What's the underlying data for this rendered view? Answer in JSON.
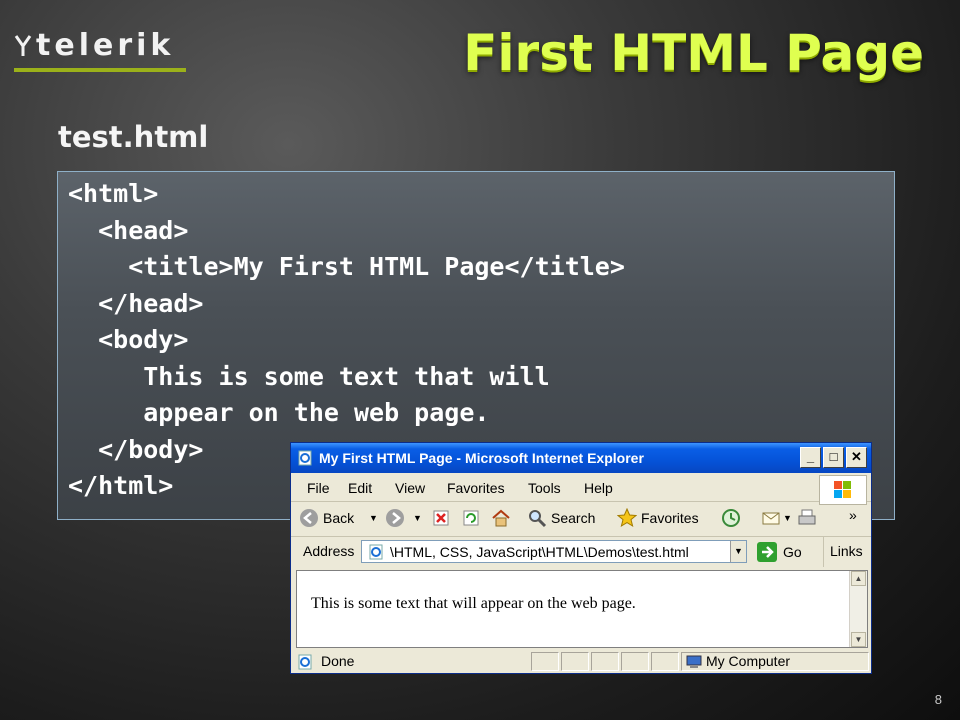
{
  "logo": {
    "text": "telerik"
  },
  "slide": {
    "title": "First HTML Page",
    "filename": "test.html",
    "code": "<html>\n  <head>\n    <title>My First HTML Page</title>\n  </head>\n  <body>\n     This is some text that will\n     appear on the web page.\n  </body>\n</html>",
    "page_number": "8"
  },
  "browser": {
    "title": "My First HTML Page - Microsoft Internet Explorer",
    "window_buttons": {
      "minimize": "_",
      "maximize": "□",
      "close": "✕"
    },
    "menu": [
      "File",
      "Edit",
      "View",
      "Favorites",
      "Tools",
      "Help"
    ],
    "toolbar": {
      "back": "Back",
      "search": "Search",
      "favorites": "Favorites"
    },
    "address": {
      "label": "Address",
      "value": "\\HTML, CSS, JavaScript\\HTML\\Demos\\test.html",
      "go": "Go",
      "links": "Links"
    },
    "content_text": "This is some text that will appear on the web page.",
    "status": {
      "left": "Done",
      "zone": "My Computer"
    }
  },
  "colors": {
    "title": "#dfff50",
    "logo_accent": "#9bb11a",
    "ie_titlebar": "#0553d8"
  }
}
